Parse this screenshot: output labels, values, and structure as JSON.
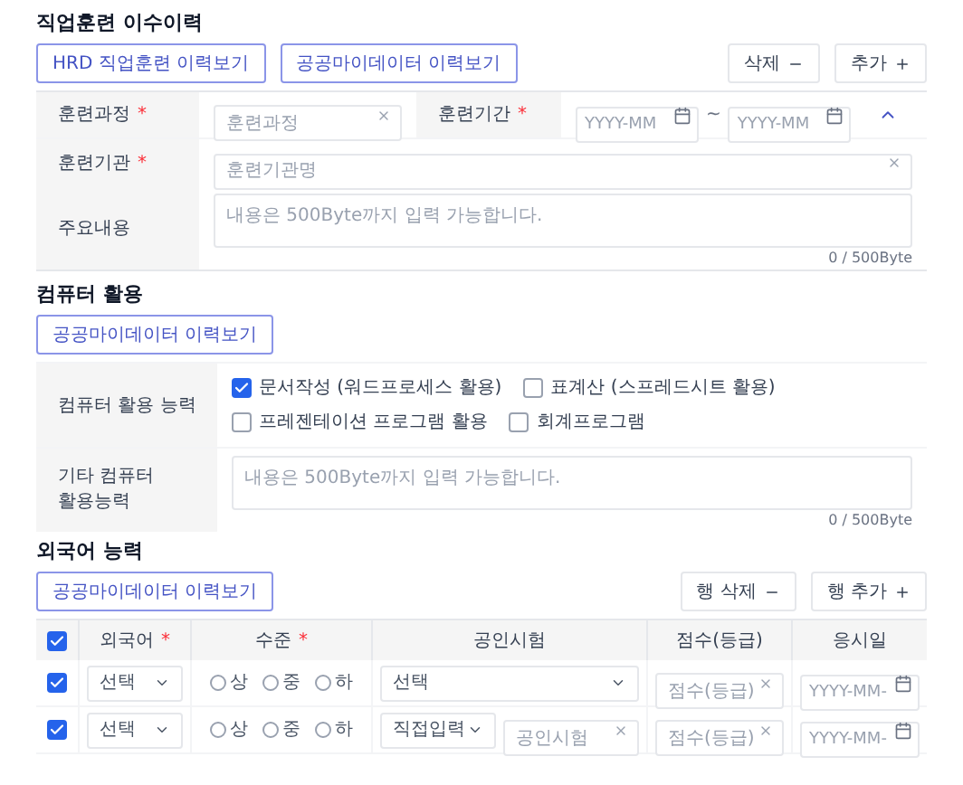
{
  "required_mark": "*",
  "training": {
    "title": "직업훈련 이수이력",
    "history_buttons": [
      "HRD 직업훈련 이력보기",
      "공공마이데이터 이력보기"
    ],
    "actions": [
      {
        "label": "삭제",
        "kind": "minus"
      },
      {
        "label": "추가",
        "kind": "plus"
      }
    ],
    "course": {
      "label": "훈련과정",
      "required": true,
      "placeholder": "훈련과정"
    },
    "period": {
      "label": "훈련기간",
      "required": true,
      "from_placeholder": "YYYY-MM",
      "separator": "~",
      "to_placeholder": "YYYY-MM",
      "expanded": true
    },
    "institution": {
      "label": "훈련기관",
      "required": true,
      "placeholder": "훈련기관명"
    },
    "content": {
      "label": "주요내용",
      "placeholder": "내용은 500Byte까지 입력 가능합니다.",
      "counter": "0 / 500Byte"
    }
  },
  "computer": {
    "title": "컴퓨터 활용",
    "history_buttons": [
      "공공마이데이터 이력보기"
    ],
    "skills": {
      "label": "컴퓨터 활용 능력",
      "options": [
        {
          "label": "문서작성 (워드프로세스 활용)",
          "checked": true
        },
        {
          "label": "표계산 (스프레드시트 활용)",
          "checked": false
        },
        {
          "label": "프레젠테이션 프로그램 활용",
          "checked": false
        },
        {
          "label": "회계프로그램",
          "checked": false
        }
      ]
    },
    "other": {
      "label_lines": [
        "기타 컴퓨터",
        "활용능력"
      ],
      "placeholder": "내용은 500Byte까지 입력 가능합니다.",
      "counter": "0 / 500Byte"
    }
  },
  "language": {
    "title": "외국어 능력",
    "history_buttons": [
      "공공마이데이터 이력보기"
    ],
    "actions": [
      {
        "label": "행 삭제",
        "kind": "minus"
      },
      {
        "label": "행 추가",
        "kind": "plus"
      }
    ],
    "table": {
      "all_checked": true,
      "columns": [
        {
          "label": "외국어",
          "required": true
        },
        {
          "label": "수준",
          "required": true
        },
        {
          "label": "공인시험",
          "required": false
        },
        {
          "label": "점수(등급)",
          "required": false
        },
        {
          "label": "응시일",
          "required": false
        }
      ],
      "rows": [
        {
          "checked": true,
          "language": "선택",
          "levels": [
            {
              "label": "상",
              "selected": false
            },
            {
              "label": "중",
              "selected": false
            },
            {
              "label": "하",
              "selected": false
            }
          ],
          "exam": {
            "kind": "select",
            "value": "선택"
          },
          "score_placeholder": "점수(등급)",
          "date_placeholder": "YYYY-MM-"
        },
        {
          "checked": true,
          "language": "선택",
          "levels": [
            {
              "label": "상",
              "selected": false
            },
            {
              "label": "중",
              "selected": false
            },
            {
              "label": "하",
              "selected": false
            }
          ],
          "exam": {
            "kind": "direct",
            "value": "직접입력",
            "placeholder": "공인시험"
          },
          "score_placeholder": "점수(등급)",
          "date_placeholder": "YYYY-MM-"
        }
      ]
    }
  }
}
